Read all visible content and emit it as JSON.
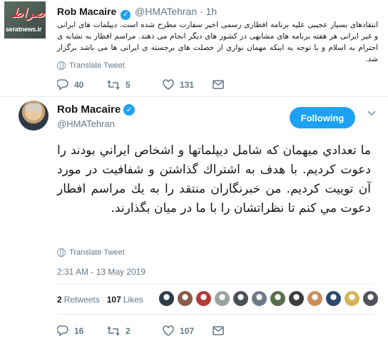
{
  "watermark": {
    "site": "seratnews.ir"
  },
  "top_tweet": {
    "name": "Rob Macaire",
    "handle": "@HMATehran",
    "dot": "·",
    "time": "1h",
    "text": "انتقادهای بسیار عجیبی علیه برنامه افطاری رسمی اخیر سفارت مطرح شده است. دیپلمات های ایرانی و غیر ایرانی هر هفته برنامه های مشابهی در کشور های دیگر انجام می دهند. مراسم افطار به نشانه ی احترام به اسلام و با توجه به اینکه مهمان نوازی از خصلت های برجسته ی ایرانی ها می باشد برگزار شد.",
    "translate_label": "Translate Tweet",
    "replies": "40",
    "retweets": "5",
    "likes": "131"
  },
  "main_tweet": {
    "name": "Rob Macaire",
    "handle": "@HMATehran",
    "follow_label": "Following",
    "text": "ما تعدادي ميهمان كه شامل ديپلماتها و اشخاص ايراني بودند را دعوت كرديم. با هدف به اشتراك گذاشتن و شفافيت در مورد آن توييت كرديم. من خبرنگاران منتقد را به يك مراسم افطار دعوت مي كنم تا نظراتشان را با ما در ميان بگذارند.",
    "translate_label": "Translate Tweet",
    "timestamp": "2:31 AM - 13 May 2019",
    "retweet_count": "2",
    "retweets_label": "Retweets",
    "like_count": "107",
    "likes_label": "Likes",
    "replies": "16",
    "retweets": "2",
    "likes": "107"
  },
  "colors": {
    "accent": "#1da1f2",
    "muted": "#657786",
    "divider": "#e6ecf0",
    "text": "#14171a"
  },
  "likers": [
    "#2f3b44",
    "#8a5a44",
    "#b33a3a",
    "#9aa5a0",
    "#4b4f56",
    "#6d7b88",
    "#5a6e4d",
    "#3d3d3d",
    "#c98f5a",
    "#2e4a6b",
    "#d6b35a",
    "#50535a"
  ]
}
